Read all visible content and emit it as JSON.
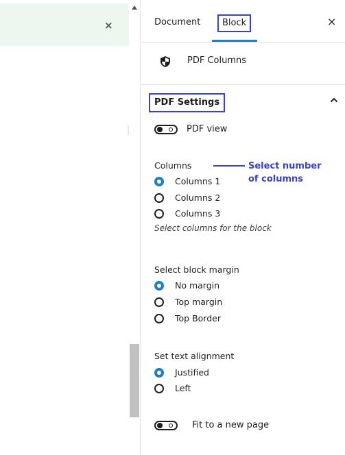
{
  "notice": {
    "close_glyph": "×"
  },
  "tabs": {
    "document": "Document",
    "block": "Block",
    "close_glyph": "×"
  },
  "block_card": {
    "icon": "shield-icon",
    "name": "PDF Columns"
  },
  "panel": {
    "title": "PDF Settings",
    "toggle_icon": "chevron-up-icon"
  },
  "pdf_view": {
    "label": "PDF view",
    "enabled": false
  },
  "columns": {
    "label": "Columns",
    "options": [
      "Columns 1",
      "Columns 2",
      "Columns 3"
    ],
    "selected": "Columns 1",
    "help": "Select columns for the block",
    "callout": "Select number of columns"
  },
  "margin": {
    "label": "Select block margin",
    "options": [
      "No margin",
      "Top margin",
      "Top Border"
    ],
    "selected": "No margin"
  },
  "alignment": {
    "label": "Set text alignment",
    "options": [
      "Justified",
      "Left"
    ],
    "selected": "Justified"
  },
  "fit_page": {
    "label": "Fit to a new page",
    "enabled": false
  },
  "colors": {
    "accent": "#1e7fc7",
    "annotation": "#3b40c9",
    "notice_bg": "#edf6ef"
  }
}
